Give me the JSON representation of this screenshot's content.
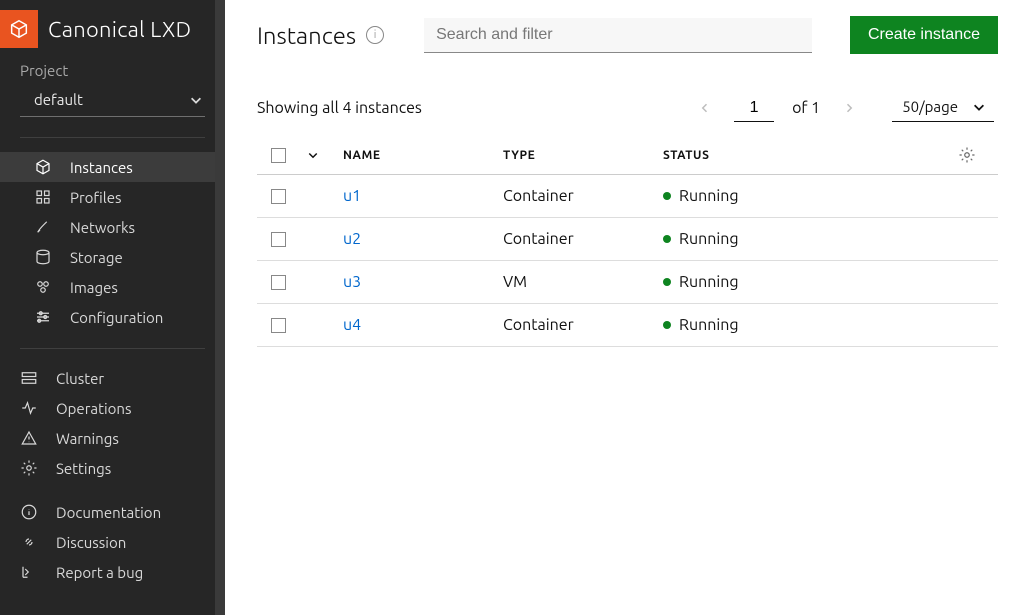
{
  "brand": {
    "title": "Canonical LXD"
  },
  "project": {
    "label": "Project",
    "value": "default"
  },
  "sidebar": {
    "primary": [
      {
        "label": "Instances"
      },
      {
        "label": "Profiles"
      },
      {
        "label": "Networks"
      },
      {
        "label": "Storage"
      },
      {
        "label": "Images"
      },
      {
        "label": "Configuration"
      }
    ],
    "secondary": [
      {
        "label": "Cluster"
      },
      {
        "label": "Operations"
      },
      {
        "label": "Warnings"
      },
      {
        "label": "Settings"
      }
    ],
    "footer": [
      {
        "label": "Documentation"
      },
      {
        "label": "Discussion"
      },
      {
        "label": "Report a bug"
      }
    ]
  },
  "header": {
    "title": "Instances",
    "search_placeholder": "Search and filter",
    "create_label": "Create instance"
  },
  "listing": {
    "showing": "Showing all 4 instances",
    "page": "1",
    "of_label": "of 1",
    "page_size": "50/page"
  },
  "columns": {
    "name": "NAME",
    "type": "TYPE",
    "status": "STATUS"
  },
  "rows": [
    {
      "name": "u1",
      "type": "Container",
      "status": "Running"
    },
    {
      "name": "u2",
      "type": "Container",
      "status": "Running"
    },
    {
      "name": "u3",
      "type": "VM",
      "status": "Running"
    },
    {
      "name": "u4",
      "type": "Container",
      "status": "Running"
    }
  ]
}
